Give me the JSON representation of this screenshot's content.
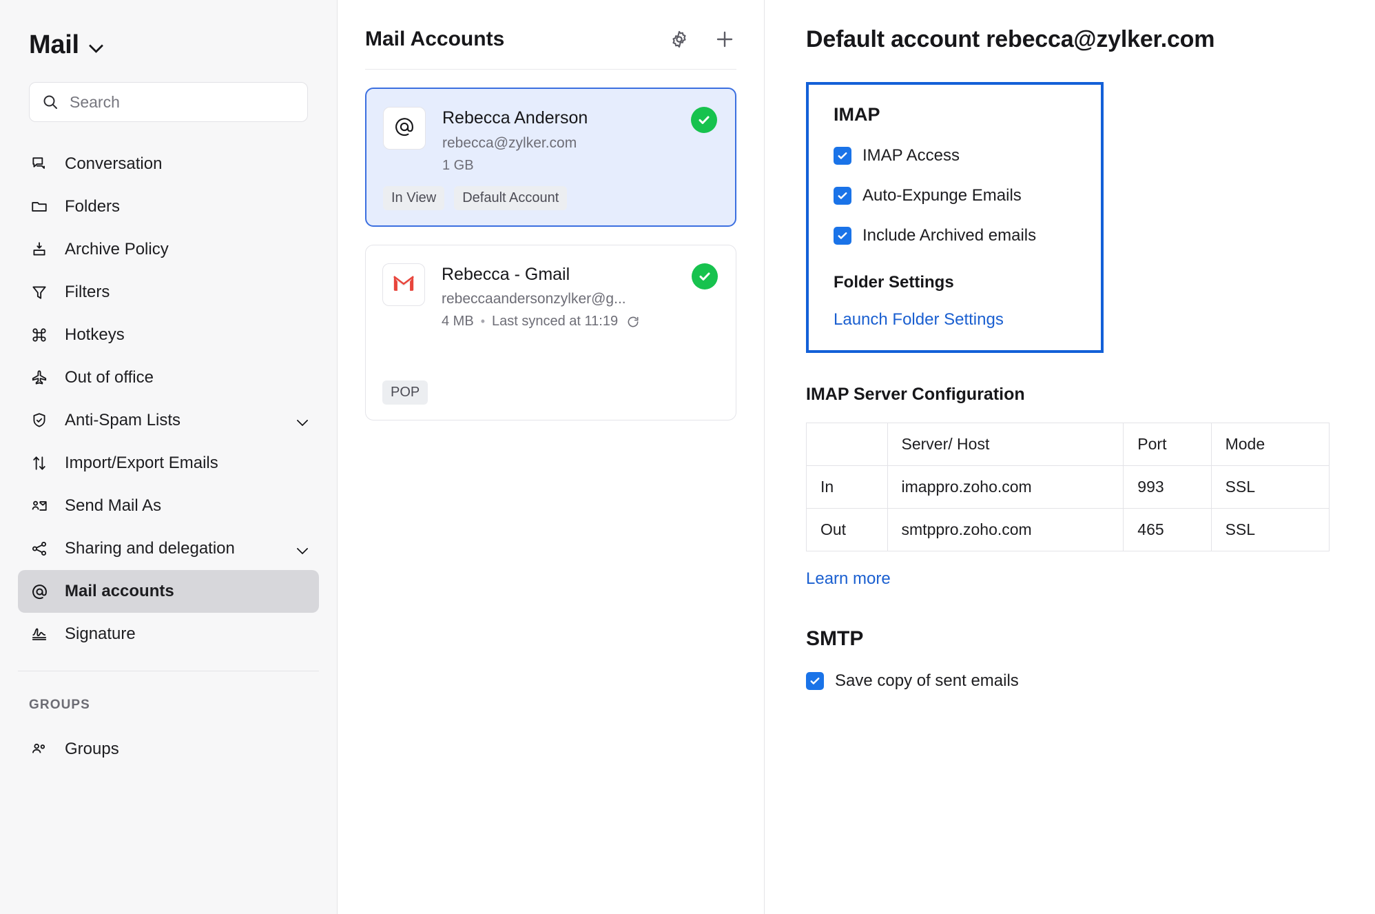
{
  "sidebar": {
    "brand": "Mail",
    "brand_chevron_icon": "chevron-down-icon",
    "search": {
      "placeholder": "Search",
      "value": "",
      "icon": "search-icon"
    },
    "items": [
      {
        "label": "Conversation",
        "icon": "conversation-icon",
        "active": false,
        "chevron": false
      },
      {
        "label": "Folders",
        "icon": "folder-icon",
        "active": false,
        "chevron": false
      },
      {
        "label": "Archive Policy",
        "icon": "archive-icon",
        "active": false,
        "chevron": false
      },
      {
        "label": "Filters",
        "icon": "filter-icon",
        "active": false,
        "chevron": false
      },
      {
        "label": "Hotkeys",
        "icon": "command-icon",
        "active": false,
        "chevron": false
      },
      {
        "label": "Out of office",
        "icon": "airplane-icon",
        "active": false,
        "chevron": false
      },
      {
        "label": "Anti-Spam Lists",
        "icon": "shield-check-icon",
        "active": false,
        "chevron": true
      },
      {
        "label": "Import/Export Emails",
        "icon": "arrows-up-down-icon",
        "active": false,
        "chevron": false
      },
      {
        "label": "Send Mail As",
        "icon": "send-mail-as-icon",
        "active": false,
        "chevron": false
      },
      {
        "label": "Sharing and delegation",
        "icon": "share-nodes-icon",
        "active": false,
        "chevron": true
      },
      {
        "label": "Mail accounts",
        "icon": "at-icon",
        "active": true,
        "chevron": false
      },
      {
        "label": "Signature",
        "icon": "signature-icon",
        "active": false,
        "chevron": false
      }
    ],
    "group_header": "GROUPS",
    "group_items": [
      {
        "label": "Groups",
        "icon": "groups-icon"
      }
    ]
  },
  "accounts_panel": {
    "title": "Mail Accounts",
    "settings_icon": "gear-icon",
    "add_icon": "plus-icon",
    "accounts": [
      {
        "avatar_icon": "at-icon",
        "name": "Rebecca Anderson",
        "email": "rebecca@zylker.com",
        "size": "1 GB",
        "sync": "",
        "status_icon": "check-circle-icon",
        "tags": [
          "In View",
          "Default Account"
        ],
        "selected": true
      },
      {
        "avatar_icon": "gmail-icon",
        "name": "Rebecca - Gmail",
        "email": "rebeccaandersonzylker@g...",
        "size": "4 MB",
        "sync": "Last synced at 11:19",
        "sync_icon": "refresh-icon",
        "status_icon": "check-circle-icon",
        "tags": [
          "POP"
        ],
        "selected": false
      }
    ]
  },
  "detail": {
    "title": "Default account rebecca@zylker.com",
    "imap": {
      "heading": "IMAP",
      "checkboxes": [
        {
          "label": "IMAP Access",
          "checked": true
        },
        {
          "label": "Auto-Expunge Emails",
          "checked": true
        },
        {
          "label": "Include Archived emails",
          "checked": true
        }
      ],
      "folder_settings_heading": "Folder Settings",
      "folder_settings_link": "Launch Folder Settings"
    },
    "server_config": {
      "title": "IMAP Server Configuration",
      "columns": [
        "",
        "Server/ Host",
        "Port",
        "Mode"
      ],
      "rows": [
        [
          "In",
          "imappro.zoho.com",
          "993",
          "SSL"
        ],
        [
          "Out",
          "smtppro.zoho.com",
          "465",
          "SSL"
        ]
      ],
      "learn_more": "Learn more"
    },
    "smtp": {
      "heading": "SMTP",
      "checkboxes": [
        {
          "label": "Save copy of sent emails",
          "checked": true
        }
      ]
    }
  },
  "colors": {
    "accent_blue": "#1360d8",
    "link_blue": "#1a5fd0",
    "checkbox_blue": "#1a73e8",
    "status_green": "#17c24e",
    "selected_card_bg": "#e6edfd",
    "sidebar_bg": "#f7f7f8"
  }
}
